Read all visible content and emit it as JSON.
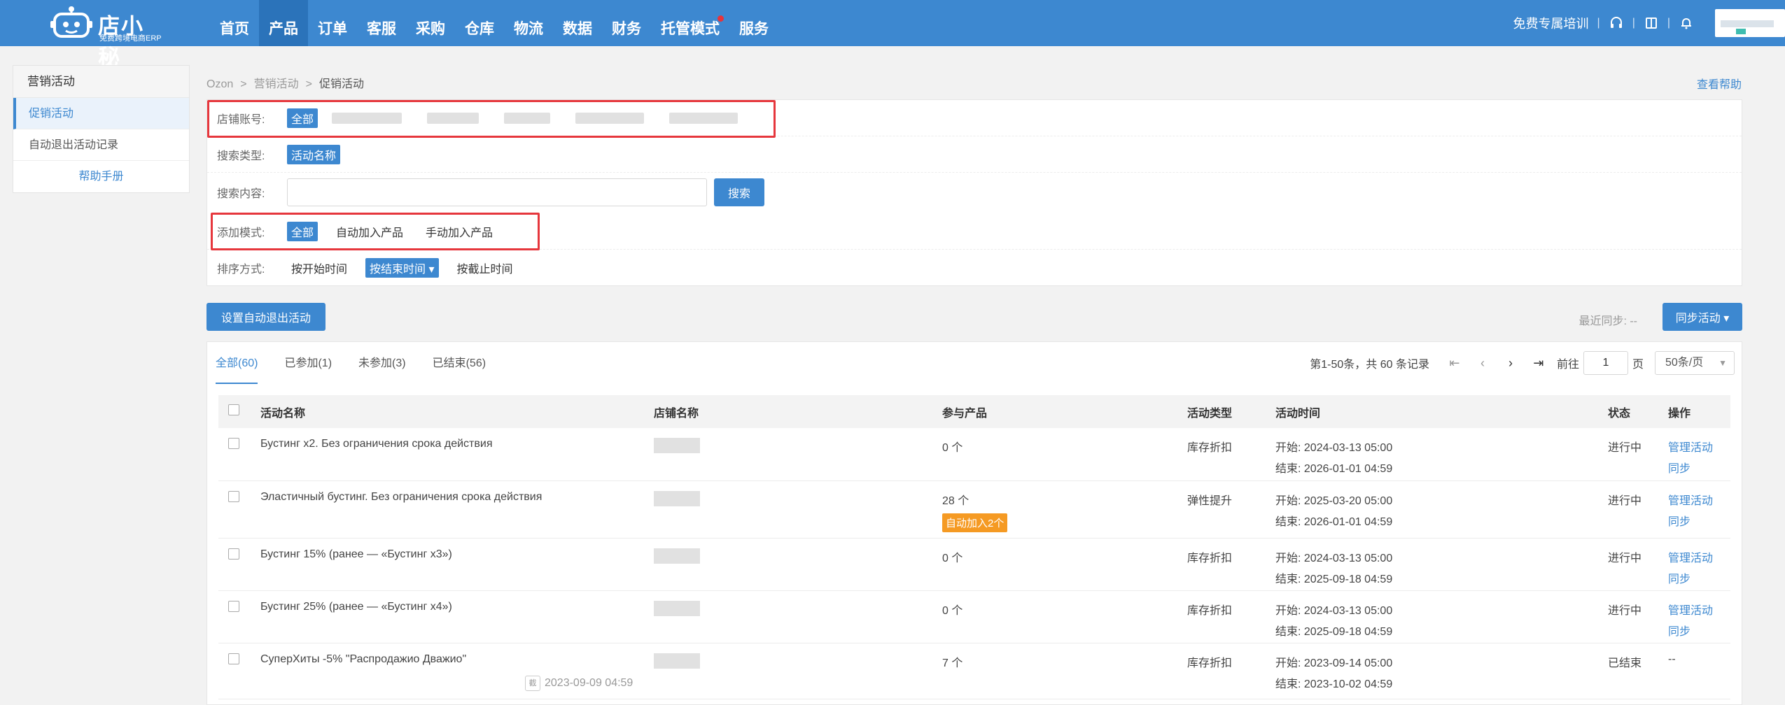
{
  "app": {
    "logo_text": "店小秘",
    "logo_sub": "免费跨境电商ERP"
  },
  "nav": {
    "items": [
      "首页",
      "产品",
      "订单",
      "客服",
      "采购",
      "仓库",
      "物流",
      "数据",
      "财务",
      "托管模式",
      "服务"
    ],
    "active": "产品"
  },
  "topright": {
    "training": "免费专属培训"
  },
  "sidebar": {
    "header": "营销活动",
    "items": [
      "促销活动",
      "自动退出活动记录"
    ],
    "help": "帮助手册"
  },
  "breadcrumb": [
    "Ozon",
    "营销活动",
    "促销活动"
  ],
  "help_link": "查看帮助",
  "filters": {
    "shop_label": "店铺账号:",
    "shop_all": "全部",
    "search_type_label": "搜索类型:",
    "search_type_value": "活动名称",
    "search_content_label": "搜索内容:",
    "search_button": "搜索",
    "add_mode_label": "添加模式:",
    "add_mode_options": [
      "全部",
      "自动加入产品",
      "手动加入产品"
    ],
    "sort_label": "排序方式:",
    "sort_options": [
      "按开始时间",
      "按结束时间 ▾",
      "按截止时间"
    ]
  },
  "actions": {
    "set_auto_exit": "设置自动退出活动",
    "last_sync": "最近同步: --",
    "sync_button": "同步活动 ▾"
  },
  "tabs": [
    "全部(60)",
    "已参加(1)",
    "未参加(3)",
    "已结束(56)"
  ],
  "pager": {
    "summary": "第1-50条，共 60 条记录",
    "goto_label": "前往",
    "page": "1",
    "page_unit": "页",
    "page_size": "50条/页"
  },
  "table": {
    "headers": [
      "活动名称",
      "店铺名称",
      "参与产品",
      "活动类型",
      "活动时间",
      "状态",
      "操作"
    ],
    "rows": [
      {
        "name": "Бустинг x2. Без ограничения срока действия",
        "products": "0 个",
        "badge": "",
        "type": "库存折扣",
        "start": "开始: 2024-03-13 05:00",
        "end": "结束: 2026-01-01 04:59",
        "status": "进行中",
        "op1": "管理活动",
        "op2": "同步",
        "extra": ""
      },
      {
        "name": "Эластичный бустинг. Без ограничения срока действия",
        "products": "28 个",
        "badge": "自动加入2个",
        "type": "弹性提升",
        "start": "开始: 2025-03-20 05:00",
        "end": "结束: 2026-01-01 04:59",
        "status": "进行中",
        "op1": "管理活动",
        "op2": "同步",
        "extra": ""
      },
      {
        "name": "Бустинг 15% (ранее — «Бустинг x3»)",
        "products": "0 个",
        "badge": "",
        "type": "库存折扣",
        "start": "开始: 2024-03-13 05:00",
        "end": "结束: 2025-09-18 04:59",
        "status": "进行中",
        "op1": "管理活动",
        "op2": "同步",
        "extra": ""
      },
      {
        "name": "Бустинг 25% (ранее — «Бустинг x4»)",
        "products": "0 个",
        "badge": "",
        "type": "库存折扣",
        "start": "开始: 2024-03-13 05:00",
        "end": "结束: 2025-09-18 04:59",
        "status": "进行中",
        "op1": "管理活动",
        "op2": "同步",
        "extra": ""
      },
      {
        "name": "СуперХиты -5% \"Распродажио Дважио\"",
        "products": "7 个",
        "badge": "",
        "type": "库存折扣",
        "start": "开始: 2023-09-14 05:00",
        "end": "结束: 2023-10-02 04:59",
        "status": "已结束",
        "op1": "--",
        "op2": "",
        "extra": "2023-09-09 04:59"
      }
    ]
  },
  "colors": {
    "primary": "#3d88d0",
    "nav_bg": "#3d88d0",
    "highlight_box": "#e6373d",
    "badge": "#f59a23"
  }
}
